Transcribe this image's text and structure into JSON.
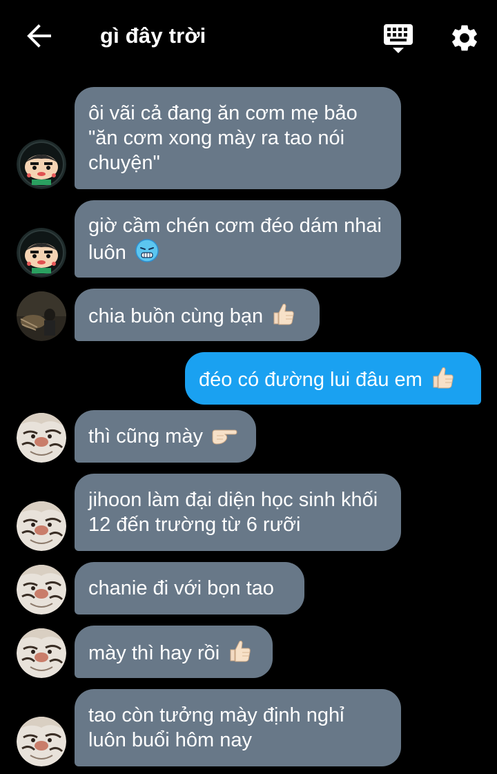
{
  "header": {
    "title": "gì đây trời",
    "back_icon": "arrow-left-icon",
    "keyboard_icon": "keyboard-icon",
    "settings_icon": "gear-icon"
  },
  "colors": {
    "background": "#000000",
    "incoming_bubble": "#687888",
    "outgoing_bubble": "#1aa1f1",
    "text": "#ffffff"
  },
  "messages": [
    {
      "direction": "incoming",
      "sender": "shinchan",
      "text": "ôi vãi cả đang ăn cơm mẹ bảo \"ăn cơm xong mày ra tao nói chuyện\""
    },
    {
      "direction": "incoming",
      "sender": "shinchan",
      "text": "giờ cầm chén cơm đéo dám nhai luôn",
      "emoji": "cold-face-icon"
    },
    {
      "direction": "incoming",
      "sender": "dark",
      "text": "chia buồn cùng bạn",
      "emoji": "thumbs-up-icon"
    },
    {
      "direction": "outgoing",
      "text": "đéo có đường lui đâu em",
      "emoji": "thumbs-up-icon"
    },
    {
      "direction": "incoming",
      "sender": "tiger",
      "text": "thì cũng mày",
      "emoji": "pointing-right-icon"
    },
    {
      "direction": "incoming",
      "sender": "tiger",
      "text": "jihoon làm đại diện học sinh khối 12 đến trường từ 6 rưỡi"
    },
    {
      "direction": "incoming",
      "sender": "tiger",
      "text": "chanie đi với bọn tao"
    },
    {
      "direction": "incoming",
      "sender": "tiger",
      "text": "mày thì hay rồi",
      "emoji": "thumbs-up-icon"
    },
    {
      "direction": "incoming",
      "sender": "tiger",
      "text": "tao còn tưởng mày định nghỉ luôn buổi hôm nay"
    }
  ]
}
